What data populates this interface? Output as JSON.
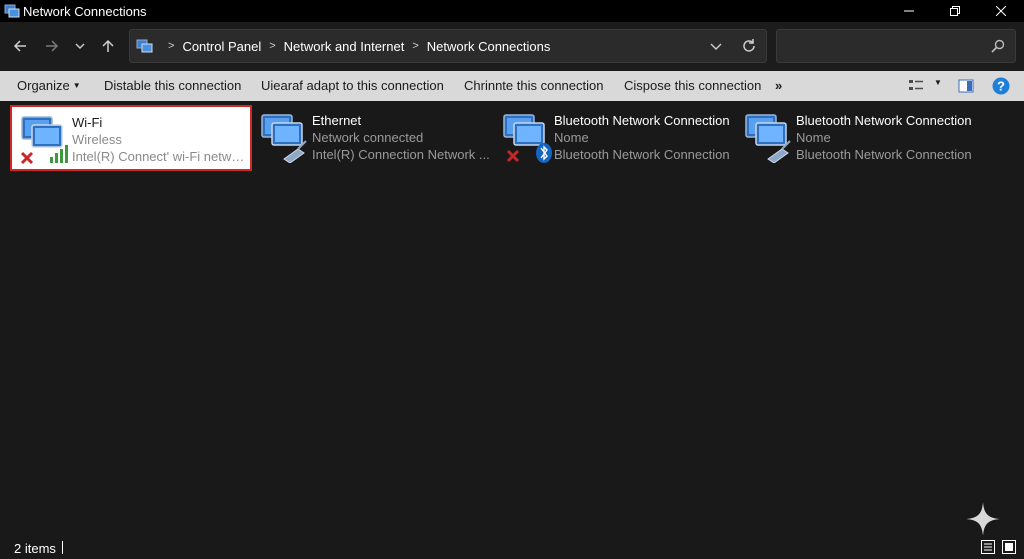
{
  "window": {
    "title": "Network Connections"
  },
  "address": {
    "crumbs": [
      "Control Panel",
      "Network and Internet",
      "Network Connections"
    ],
    "search_placeholder": ""
  },
  "toolbar": {
    "organize": "Organize",
    "disable": "Distable this connection",
    "diagnose": "Uiearaf adapt to this connection",
    "rename": "Chrinnte this connection",
    "status": "Cispose this connection",
    "more": "»"
  },
  "connections": [
    {
      "name": "Wi-Fi",
      "status": "Wireless",
      "device": "Intel(R) Connect' wi-Fi networ...",
      "selected": true
    },
    {
      "name": "Ethernet",
      "status": "Network connected",
      "device": "Intel(R) Connection Network ...",
      "selected": false
    },
    {
      "name": "Bluetooth Network Connection",
      "status": "Nome",
      "device": "Bluetooth Network Connection",
      "selected": false
    },
    {
      "name": "Bluetooth Network Connection",
      "status": "Nome",
      "device": "Bluetooth Network Connection",
      "selected": false
    }
  ],
  "status_bar": {
    "item_count": "2 items"
  },
  "colors": {
    "background": "#191919",
    "command_bar": "#d9d9d9",
    "selection_border": "#d32626",
    "help_blue": "#1e7fd8"
  },
  "icons": {
    "app": "network-connections-icon",
    "back": "back-arrow-icon",
    "forward": "forward-arrow-icon",
    "recent": "chevron-down-icon",
    "up": "up-arrow-icon",
    "refresh": "refresh-icon",
    "search": "search-icon",
    "help": "help-icon"
  }
}
